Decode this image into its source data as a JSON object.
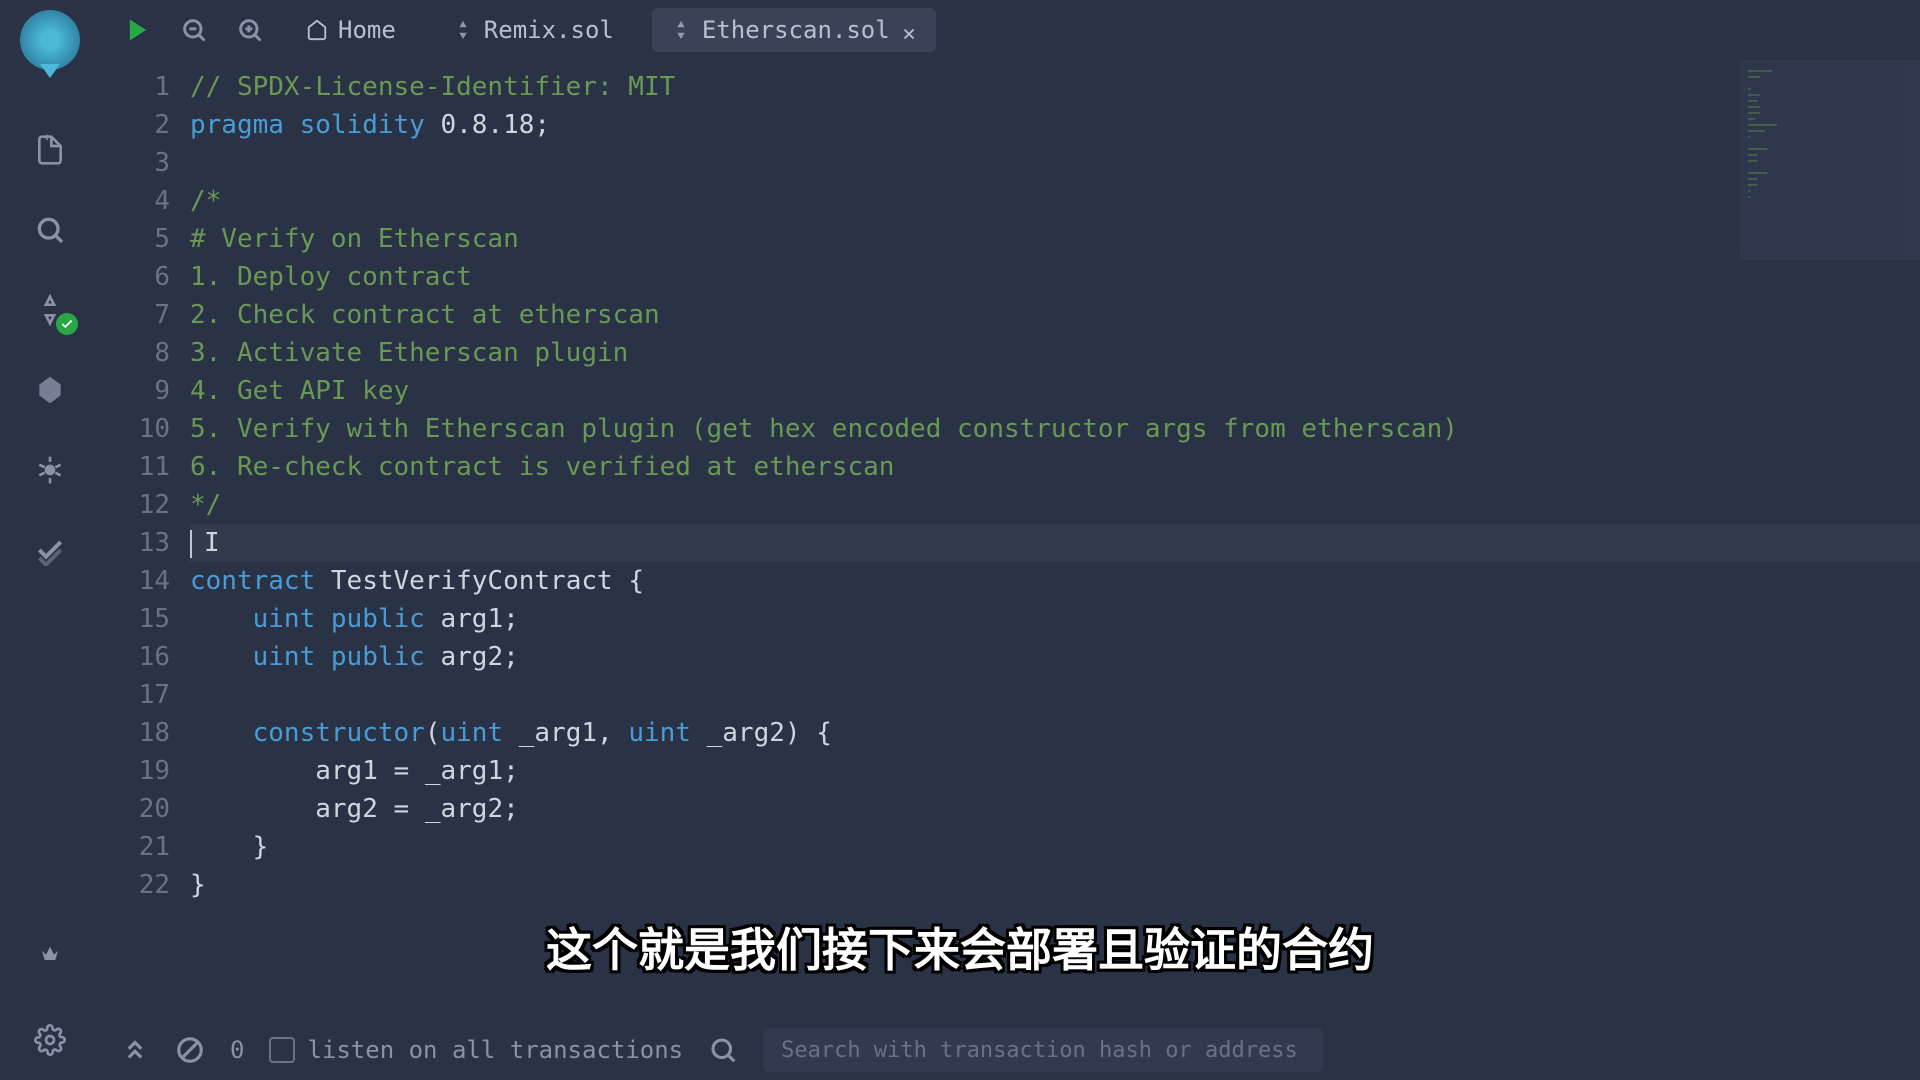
{
  "tabs": {
    "home": "Home",
    "remix": "Remix.sol",
    "etherscan": "Etherscan.sol"
  },
  "code": {
    "lines": [
      {
        "n": 1,
        "tokens": [
          {
            "t": "comment",
            "v": "// SPDX-License-Identifier: MIT"
          }
        ]
      },
      {
        "n": 2,
        "tokens": [
          {
            "t": "keyword",
            "v": "pragma"
          },
          {
            "t": "sp",
            "v": " "
          },
          {
            "t": "keyword",
            "v": "solidity"
          },
          {
            "t": "sp",
            "v": " "
          },
          {
            "t": "name",
            "v": "0.8.18"
          },
          {
            "t": "punc",
            "v": ";"
          }
        ]
      },
      {
        "n": 3,
        "tokens": []
      },
      {
        "n": 4,
        "tokens": [
          {
            "t": "comment",
            "v": "/*"
          }
        ]
      },
      {
        "n": 5,
        "tokens": [
          {
            "t": "comment",
            "v": "# Verify on Etherscan"
          }
        ]
      },
      {
        "n": 6,
        "tokens": [
          {
            "t": "comment",
            "v": "1. Deploy contract"
          }
        ]
      },
      {
        "n": 7,
        "tokens": [
          {
            "t": "comment",
            "v": "2. Check contract at etherscan"
          }
        ]
      },
      {
        "n": 8,
        "tokens": [
          {
            "t": "comment",
            "v": "3. Activate Etherscan plugin"
          }
        ]
      },
      {
        "n": 9,
        "tokens": [
          {
            "t": "comment",
            "v": "4. Get API key"
          }
        ]
      },
      {
        "n": 10,
        "tokens": [
          {
            "t": "comment",
            "v": "5. Verify with Etherscan plugin (get hex encoded constructor args from etherscan)"
          }
        ]
      },
      {
        "n": 11,
        "tokens": [
          {
            "t": "comment",
            "v": "6. Re-check contract is verified at etherscan"
          }
        ]
      },
      {
        "n": 12,
        "tokens": [
          {
            "t": "comment",
            "v": "*/"
          }
        ]
      },
      {
        "n": 13,
        "tokens": [],
        "current": true,
        "cursor": true
      },
      {
        "n": 14,
        "tokens": [
          {
            "t": "keyword",
            "v": "contract"
          },
          {
            "t": "sp",
            "v": " "
          },
          {
            "t": "name",
            "v": "TestVerifyContract"
          },
          {
            "t": "sp",
            "v": " "
          },
          {
            "t": "punc",
            "v": "{"
          }
        ]
      },
      {
        "n": 15,
        "tokens": [
          {
            "t": "sp",
            "v": "    "
          },
          {
            "t": "type",
            "v": "uint"
          },
          {
            "t": "sp",
            "v": " "
          },
          {
            "t": "keyword",
            "v": "public"
          },
          {
            "t": "sp",
            "v": " "
          },
          {
            "t": "name",
            "v": "arg1"
          },
          {
            "t": "punc",
            "v": ";"
          }
        ]
      },
      {
        "n": 16,
        "tokens": [
          {
            "t": "sp",
            "v": "    "
          },
          {
            "t": "type",
            "v": "uint"
          },
          {
            "t": "sp",
            "v": " "
          },
          {
            "t": "keyword",
            "v": "public"
          },
          {
            "t": "sp",
            "v": " "
          },
          {
            "t": "name",
            "v": "arg2"
          },
          {
            "t": "punc",
            "v": ";"
          }
        ]
      },
      {
        "n": 17,
        "tokens": []
      },
      {
        "n": 18,
        "tokens": [
          {
            "t": "sp",
            "v": "    "
          },
          {
            "t": "keyword",
            "v": "constructor"
          },
          {
            "t": "punc",
            "v": "("
          },
          {
            "t": "type",
            "v": "uint"
          },
          {
            "t": "sp",
            "v": " "
          },
          {
            "t": "name",
            "v": "_arg1"
          },
          {
            "t": "punc",
            "v": ","
          },
          {
            "t": "sp",
            "v": " "
          },
          {
            "t": "type",
            "v": "uint"
          },
          {
            "t": "sp",
            "v": " "
          },
          {
            "t": "name",
            "v": "_arg2"
          },
          {
            "t": "punc",
            "v": ")"
          },
          {
            "t": "sp",
            "v": " "
          },
          {
            "t": "punc",
            "v": "{"
          }
        ]
      },
      {
        "n": 19,
        "tokens": [
          {
            "t": "sp",
            "v": "        "
          },
          {
            "t": "name",
            "v": "arg1"
          },
          {
            "t": "sp",
            "v": " "
          },
          {
            "t": "op",
            "v": "="
          },
          {
            "t": "sp",
            "v": " "
          },
          {
            "t": "name",
            "v": "_arg1"
          },
          {
            "t": "punc",
            "v": ";"
          }
        ]
      },
      {
        "n": 20,
        "tokens": [
          {
            "t": "sp",
            "v": "        "
          },
          {
            "t": "name",
            "v": "arg2"
          },
          {
            "t": "sp",
            "v": " "
          },
          {
            "t": "op",
            "v": "="
          },
          {
            "t": "sp",
            "v": " "
          },
          {
            "t": "name",
            "v": "_arg2"
          },
          {
            "t": "punc",
            "v": ";"
          }
        ]
      },
      {
        "n": 21,
        "tokens": [
          {
            "t": "sp",
            "v": "    "
          },
          {
            "t": "punc",
            "v": "}"
          }
        ]
      },
      {
        "n": 22,
        "tokens": [
          {
            "t": "punc",
            "v": "}"
          }
        ]
      }
    ]
  },
  "bottom": {
    "count": "0",
    "listen": "listen on all transactions",
    "searchPlaceholder": "Search with transaction hash or address"
  },
  "subtitle": "这个就是我们接下来会部署且验证的合约"
}
